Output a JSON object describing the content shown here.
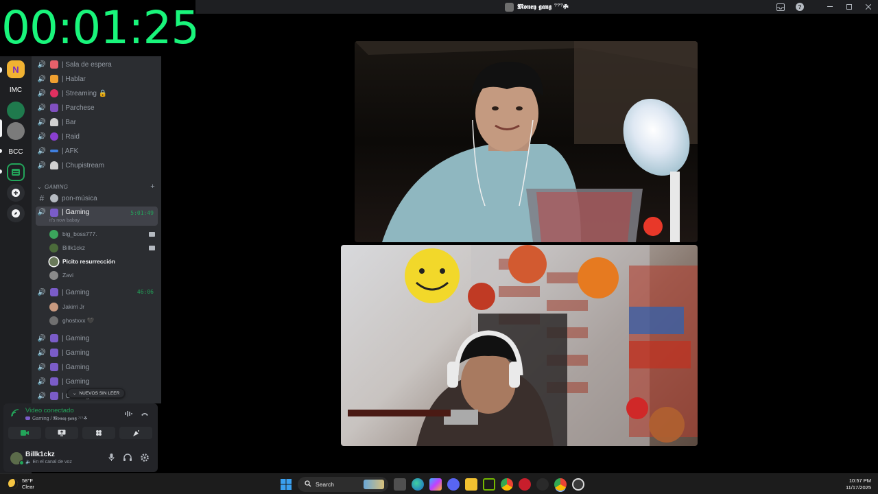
{
  "timer": "00:01:25",
  "window": {
    "title": "𝕸𝖔𝖓𝖊𝖞 𝖌𝖆𝖓𝖌 ⁷⁷⁷☘"
  },
  "rail": {
    "items": [
      "N",
      "IMC",
      "BCC"
    ]
  },
  "channels": {
    "voice_top": [
      {
        "label": "| Sala de espera",
        "emoji_color": "#e8606a"
      },
      {
        "label": "| Hablar",
        "emoji_color": "#f0a030"
      },
      {
        "label": "| Streaming 🔒",
        "emoji_color": "#e03060"
      },
      {
        "label": "| Parchese",
        "emoji_color": "#8050c0"
      },
      {
        "label": "| Bar",
        "emoji_color": "#d0d0d0"
      },
      {
        "label": "| Raid",
        "emoji_color": "#8a3fd0"
      },
      {
        "label": "| AFK",
        "emoji_color": "#4080e0"
      },
      {
        "label": "| Chupistream",
        "emoji_color": "#d0d0d0"
      }
    ],
    "category": "GAMING",
    "text_channel": "pon-música",
    "active": {
      "label": "| Gaming",
      "duration": "5:01:49",
      "status": "it's now babay"
    },
    "active_users": [
      {
        "name": "big_boss777.",
        "has_camera": true,
        "avatar_color": "#3ba55c"
      },
      {
        "name": "Billk1ckz",
        "has_camera": true,
        "avatar_color": "#4b6b3a"
      },
      {
        "name": "Picito resurrección",
        "has_camera": false,
        "avatar_color": "#6a7a5a"
      },
      {
        "name": "Zavi",
        "has_camera": false,
        "avatar_color": "#8a8a8a"
      }
    ],
    "second": {
      "label": "| Gaming",
      "duration": "46:06"
    },
    "second_users": [
      {
        "name": "Jakirri Jr",
        "avatar_color": "#c89a80"
      },
      {
        "name": "ghostxxx 🖤",
        "avatar_color": "#707070"
      }
    ],
    "voice_bottom": [
      "| Gaming",
      "| Gaming",
      "| Gaming",
      "| Gaming",
      "| Gaming"
    ],
    "unread_label": "NUEVOS SIN LEER"
  },
  "voice_panel": {
    "status": "Video conectado",
    "path": "Gaming / 𝕸𝖔𝖓𝖊𝖞 𝖌𝖆𝖓𝖌 ⁷⁷⁷☘",
    "accent_color": "#23a55a"
  },
  "account": {
    "name": "Billk1ckz",
    "status": "En el canal de voz"
  },
  "taskbar": {
    "temperature": "58°F",
    "condition": "Clear",
    "search_label": "Search",
    "time": "10:57 PM",
    "date": "11/17/2025"
  }
}
